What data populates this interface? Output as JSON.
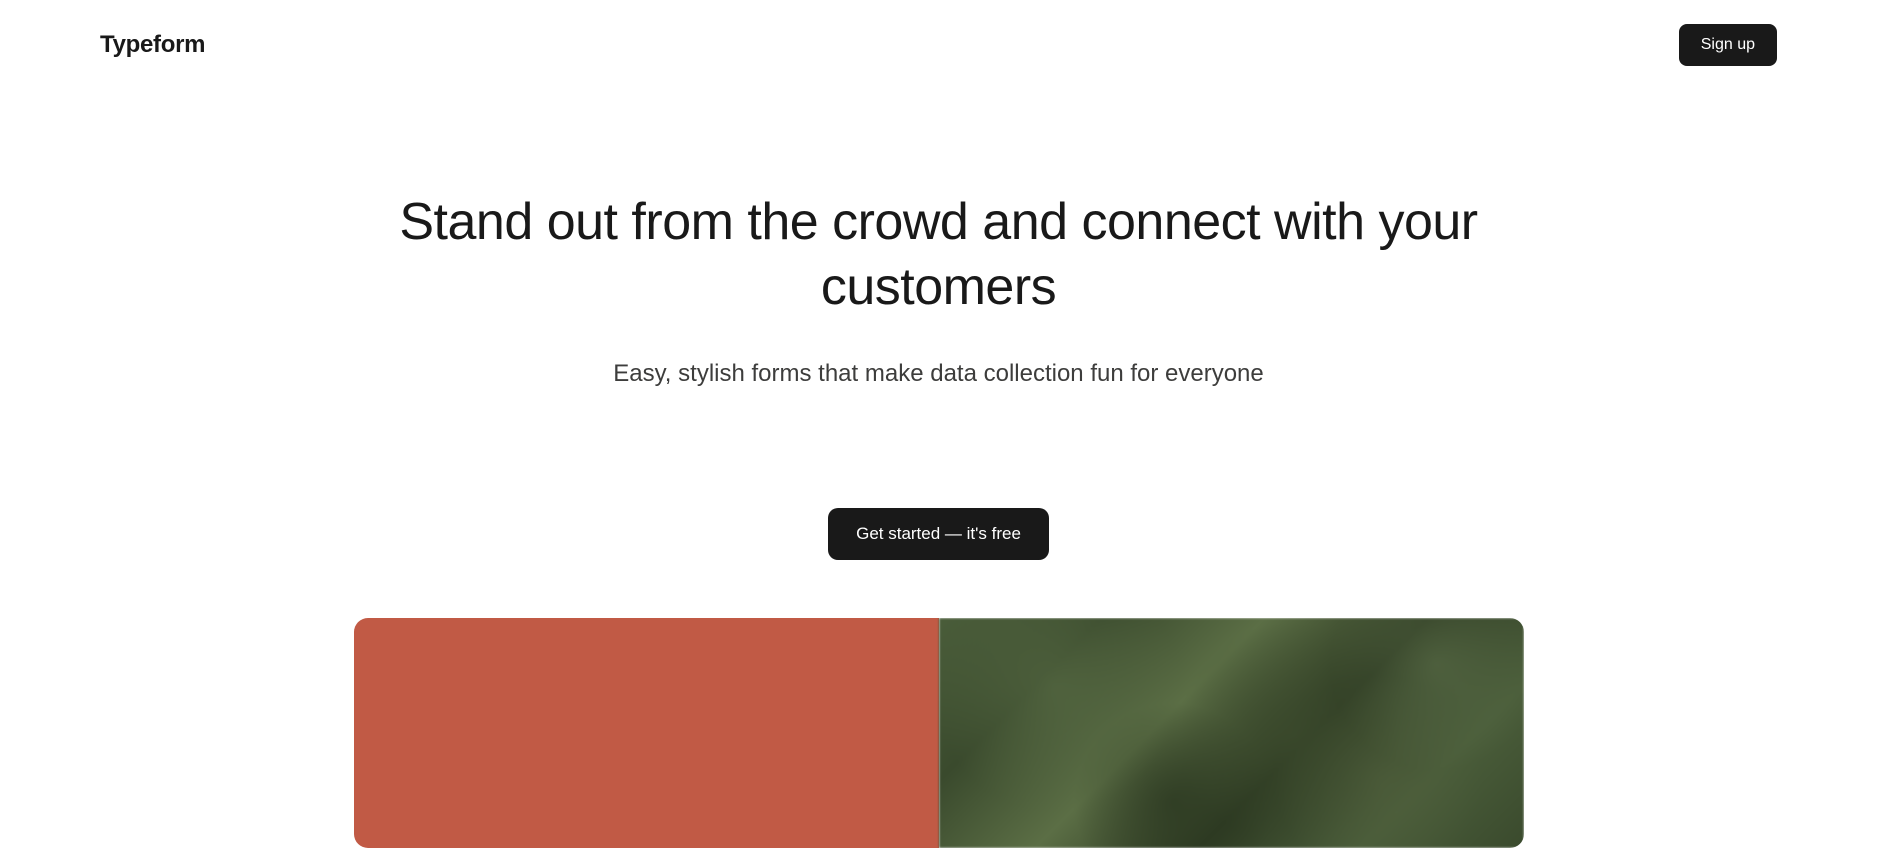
{
  "header": {
    "logo": "Typeform",
    "signup_label": "Sign up"
  },
  "hero": {
    "title": "Stand out from the crowd and connect with your customers",
    "subtitle": "Easy, stylish forms that make data collection fun for everyone",
    "cta_label": "Get started — it's free"
  },
  "colors": {
    "primary": "#191919",
    "accent_red": "#c15a45",
    "text_secondary": "#3d3d3c"
  }
}
